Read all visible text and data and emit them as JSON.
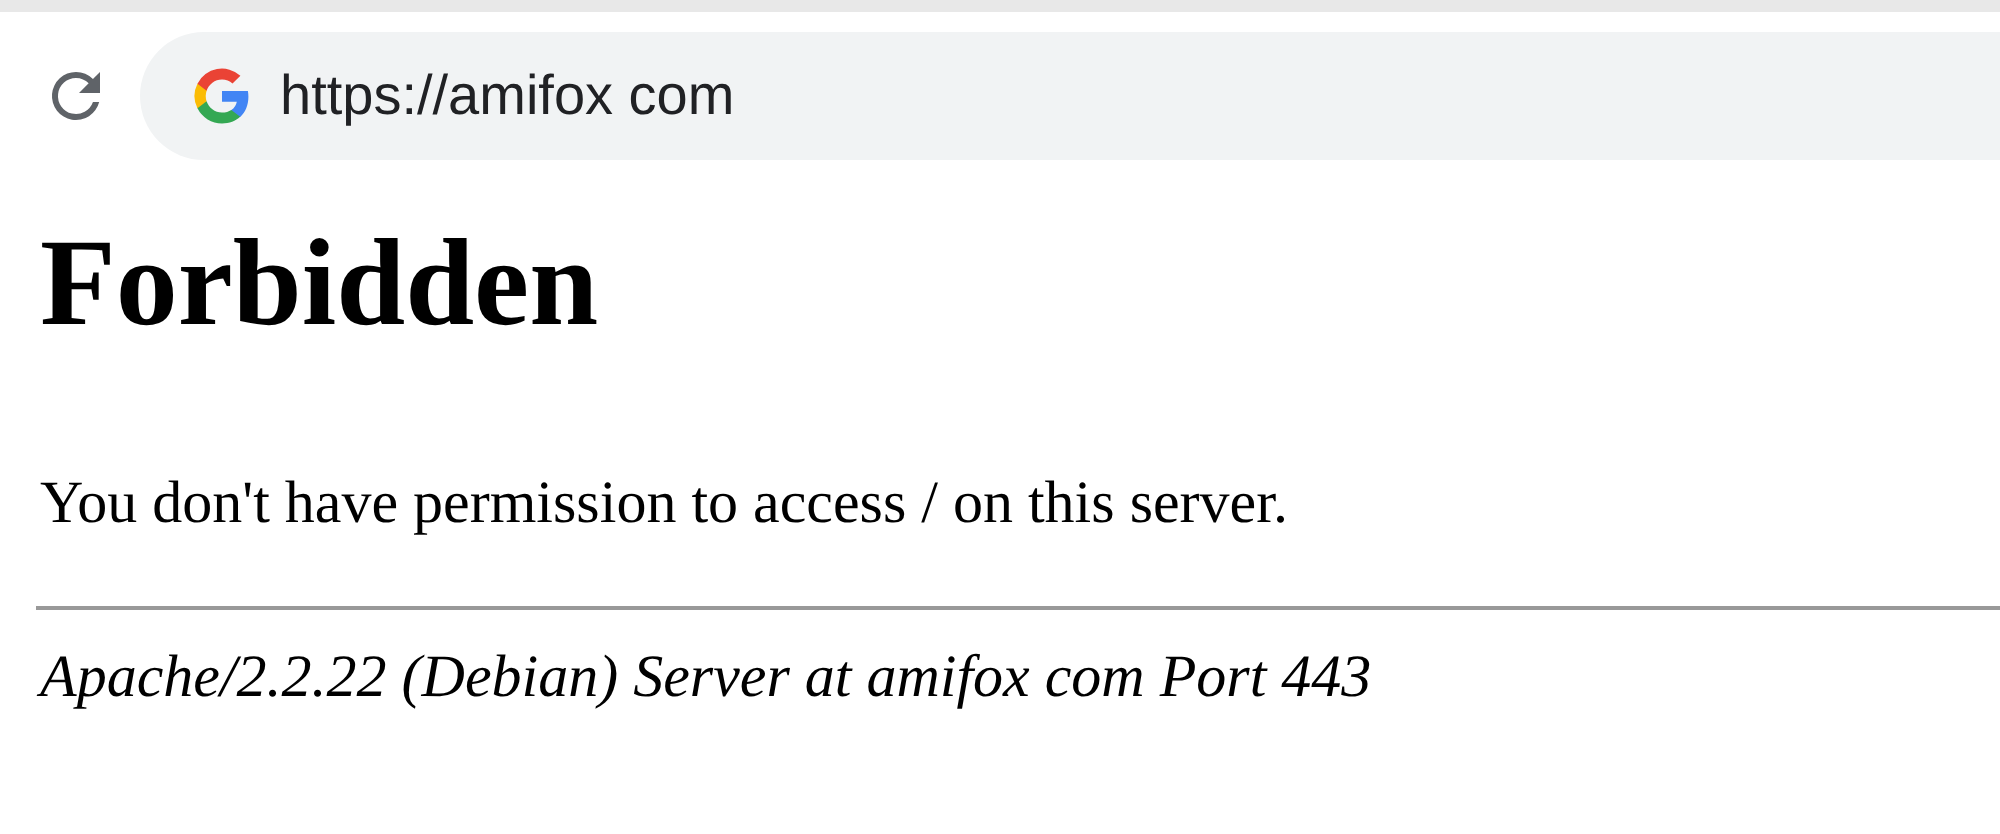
{
  "toolbar": {
    "url": "https://amifox com"
  },
  "page": {
    "heading": "Forbidden",
    "message": "You don't have permission to access / on this server.",
    "address": "Apache/2.2.22 (Debian) Server at amifox com Port 443"
  }
}
